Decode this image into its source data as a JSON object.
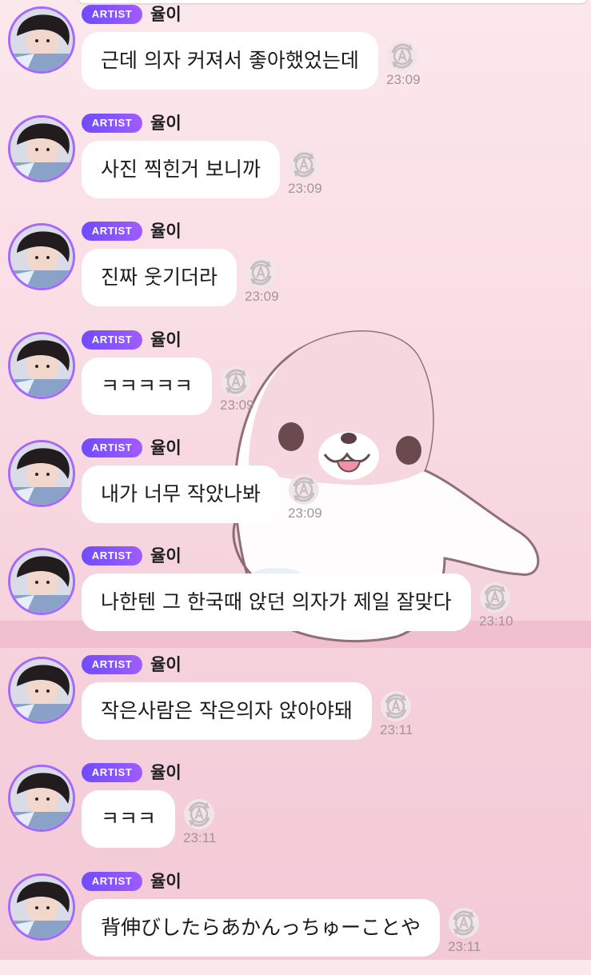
{
  "chat": {
    "messages": [
      {
        "badge": "ARTIST",
        "sender": "율이",
        "text": "근데 의자 커져서 좋아했었는데",
        "time": "23:09"
      },
      {
        "badge": "ARTIST",
        "sender": "율이",
        "text": "사진 찍힌거 보니까",
        "time": "23:09"
      },
      {
        "badge": "ARTIST",
        "sender": "율이",
        "text": "진짜 웃기더라",
        "time": "23:09"
      },
      {
        "badge": "ARTIST",
        "sender": "율이",
        "text": "ㅋㅋㅋㅋㅋ",
        "time": "23:09"
      },
      {
        "badge": "ARTIST",
        "sender": "율이",
        "text": "내가 너무 작았나봐",
        "time": "23:09"
      },
      {
        "badge": "ARTIST",
        "sender": "율이",
        "text": "나한텐 그 한국때 앉던 의자가 제일 잘맞다",
        "time": "23:10"
      },
      {
        "badge": "ARTIST",
        "sender": "율이",
        "text": "작은사람은 작은의자 앉아야돼",
        "time": "23:11"
      },
      {
        "badge": "ARTIST",
        "sender": "율이",
        "text": "ㅋㅋㅋ",
        "time": "23:11"
      },
      {
        "badge": "ARTIST",
        "sender": "율이",
        "text": "背伸びしたらあかんっちゅーことや",
        "time": "23:11"
      }
    ]
  },
  "icons": {
    "avatar": "profile-photo",
    "read_status": "translate-a-icon",
    "background": "seal-sticker"
  },
  "colors": {
    "badge_start": "#6f4cff",
    "badge_end": "#a05cff",
    "avatar_ring": "#a468ff",
    "bubble": "#ffffff",
    "time": "#a0969a"
  }
}
